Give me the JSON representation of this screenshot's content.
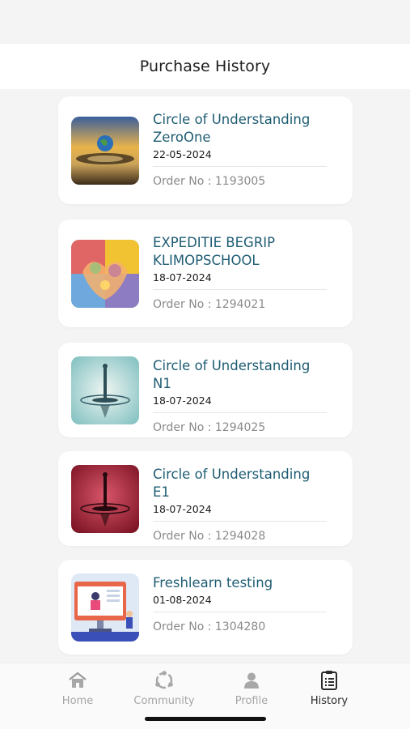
{
  "header": {
    "title": "Purchase History"
  },
  "orders": [
    {
      "title": "Circle of Understanding ZeroOne",
      "date": "22-05-2024",
      "order": "Order No : 1193005",
      "thumb": "earth-drop-icon"
    },
    {
      "title": "EXPEDITIE BEGRIP KLIMOPSCHOOL",
      "date": "18-07-2024",
      "order": "Order No : 1294021",
      "thumb": "colorful-hands-icon"
    },
    {
      "title": "Circle of Understanding N1",
      "date": "18-07-2024",
      "order": "Order No : 1294025",
      "thumb": "water-drop-teal-icon"
    },
    {
      "title": "Circle of Understanding E1",
      "date": "18-07-2024",
      "order": "Order No : 1294028",
      "thumb": "water-drop-red-icon"
    },
    {
      "title": "Freshlearn testing",
      "date": "01-08-2024",
      "order": "Order No : 1304280",
      "thumb": "online-class-icon"
    }
  ],
  "tabs": [
    {
      "label": "Home",
      "icon": "home-icon"
    },
    {
      "label": "Community",
      "icon": "community-icon"
    },
    {
      "label": "Profile",
      "icon": "profile-icon"
    },
    {
      "label": "History",
      "icon": "history-icon",
      "active": true
    }
  ],
  "colors": {
    "title": "#1f5d73",
    "active_tab": "#2b2b2b",
    "inactive_tab": "#a5a5a5"
  }
}
